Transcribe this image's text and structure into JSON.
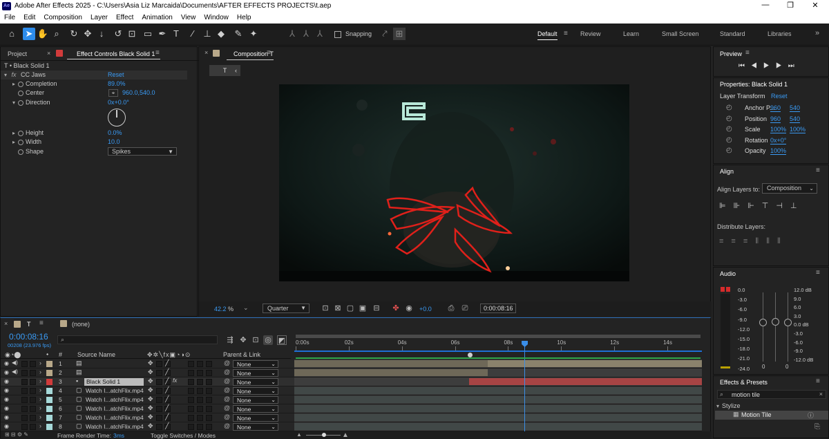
{
  "window": {
    "app_badge": "Ae",
    "title": "Adobe After Effects 2025 - C:\\Users\\Asia Liz Marcaida\\Documents\\AFTER EFFECTS PROJECTS\\t.aep",
    "minimize": "—",
    "restore": "❐",
    "close": "✕"
  },
  "menu": [
    "File",
    "Edit",
    "Composition",
    "Layer",
    "Effect",
    "Animation",
    "View",
    "Window",
    "Help"
  ],
  "toolbar": {
    "snapping_label": "Snapping",
    "workspaces": [
      "Default",
      "Review",
      "Learn",
      "Small Screen",
      "Standard",
      "Libraries"
    ],
    "active_workspace": "Default"
  },
  "left_panel": {
    "tab_project": "Project",
    "tab_effect_controls": "Effect Controls Black Solid 1",
    "layer_path": "T • Black Solid 1",
    "effect_name": "CC Jaws",
    "effect_reset": "Reset",
    "props": [
      {
        "name": "Completion",
        "value": "89.0%"
      },
      {
        "name": "Center",
        "value": "960.0,540.0"
      },
      {
        "name": "Direction",
        "value": "0x+0.0°"
      },
      {
        "name": "Height",
        "value": "0.0%"
      },
      {
        "name": "Width",
        "value": "10.0"
      },
      {
        "name": "Shape",
        "value": "Spikes"
      }
    ]
  },
  "composition": {
    "tab_label": "Composition T",
    "breadcrumb": "T",
    "zoom": "42.2",
    "zoom_unit": "%",
    "resolution": "Quarter",
    "exposure": "+0.0",
    "timecode": "0:00:08:16"
  },
  "timeline": {
    "tab_label": "T",
    "tab_none": "(none)",
    "timecode": "0:00:08:16",
    "frame_info": "00208 (23.976 fps)",
    "col_hash": "#",
    "col_source": "Source Name",
    "col_parent": "Parent & Link",
    "ruler_ticks": [
      "0:00s",
      "02s",
      "04s",
      "06s",
      "08s",
      "10s",
      "12s",
      "14s"
    ],
    "playhead_fraction": 0.565,
    "layers": [
      {
        "num": "1",
        "name": "",
        "color": "#b8a889",
        "parent": "None"
      },
      {
        "num": "2",
        "name": "",
        "color": "#b8a889",
        "parent": "None"
      },
      {
        "num": "3",
        "name": "Black Solid 1",
        "color": "#d13b3b",
        "parent": "None"
      },
      {
        "num": "4",
        "name": "Watch I...atchFlix.mp4",
        "color": "#a6d9d9",
        "parent": "None"
      },
      {
        "num": "5",
        "name": "Watch I...atchFlix.mp4",
        "color": "#a6d9d9",
        "parent": "None"
      },
      {
        "num": "6",
        "name": "Watch I...atchFlix.mp4",
        "color": "#a6d9d9",
        "parent": "None"
      },
      {
        "num": "7",
        "name": "Watch I...atchFlix.mp4",
        "color": "#a6d9d9",
        "parent": "None"
      },
      {
        "num": "8",
        "name": "Watch I...atchFlix.mp4",
        "color": "#a6d9d9",
        "parent": "None"
      }
    ],
    "footer_render_label": "Frame Render Time:",
    "footer_render_value": "3ms",
    "footer_toggle": "Toggle Switches / Modes"
  },
  "preview": {
    "title": "Preview"
  },
  "properties": {
    "title": "Properties: Black Solid 1",
    "section": "Layer Transform",
    "reset": "Reset",
    "rows": [
      {
        "name": "Anchor P...",
        "v1": "960",
        "v2": "540"
      },
      {
        "name": "Position",
        "v1": "960",
        "v2": "540"
      },
      {
        "name": "Scale",
        "v1": "100%",
        "v2": "100%"
      },
      {
        "name": "Rotation",
        "v1": "0x+0°",
        "v2": ""
      },
      {
        "name": "Opacity",
        "v1": "100%",
        "v2": ""
      }
    ]
  },
  "align": {
    "title": "Align",
    "align_to_label": "Align Layers to:",
    "align_to_value": "Composition",
    "distribute_label": "Distribute Layers:"
  },
  "audio": {
    "title": "Audio",
    "left_scale": [
      "0.0",
      "-3.0",
      "-6.0",
      "-9.0",
      "-12.0",
      "-15.0",
      "-18.0",
      "-21.0",
      "-24.0"
    ],
    "right_scale": [
      "12.0 dB",
      "9.0",
      "6.0",
      "3.0",
      "0.0 dB",
      "-3.0",
      "-6.0",
      "-9.0",
      "-12.0 dB"
    ],
    "zero_left": "0",
    "zero_right": "0"
  },
  "effects_presets": {
    "title": "Effects & Presets",
    "search_value": "motion tile",
    "category": "Stylize",
    "result": "Motion Tile"
  }
}
